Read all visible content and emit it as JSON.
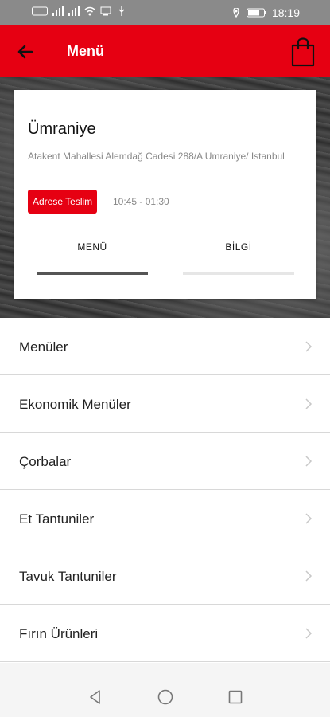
{
  "status_bar": {
    "time": "18:19"
  },
  "app_bar": {
    "title": "Menü"
  },
  "store": {
    "name": "Ümraniye",
    "address": "Atakent Mahallesi Alemdağ Cadesi 288/A Umraniye/ Istanbul",
    "delivery_badge": "Adrese Teslim",
    "hours": "10:45 - 01:30",
    "tabs": [
      {
        "label": "MENÜ",
        "active": true
      },
      {
        "label": "BİLGİ",
        "active": false
      }
    ]
  },
  "categories": [
    {
      "label": "Menüler"
    },
    {
      "label": "Ekonomik Menüler"
    },
    {
      "label": "Çorbalar"
    },
    {
      "label": "Et Tantuniler"
    },
    {
      "label": "Tavuk Tantuniler"
    },
    {
      "label": "Fırın Ürünleri"
    }
  ],
  "colors": {
    "brand_red": "#e60012"
  }
}
